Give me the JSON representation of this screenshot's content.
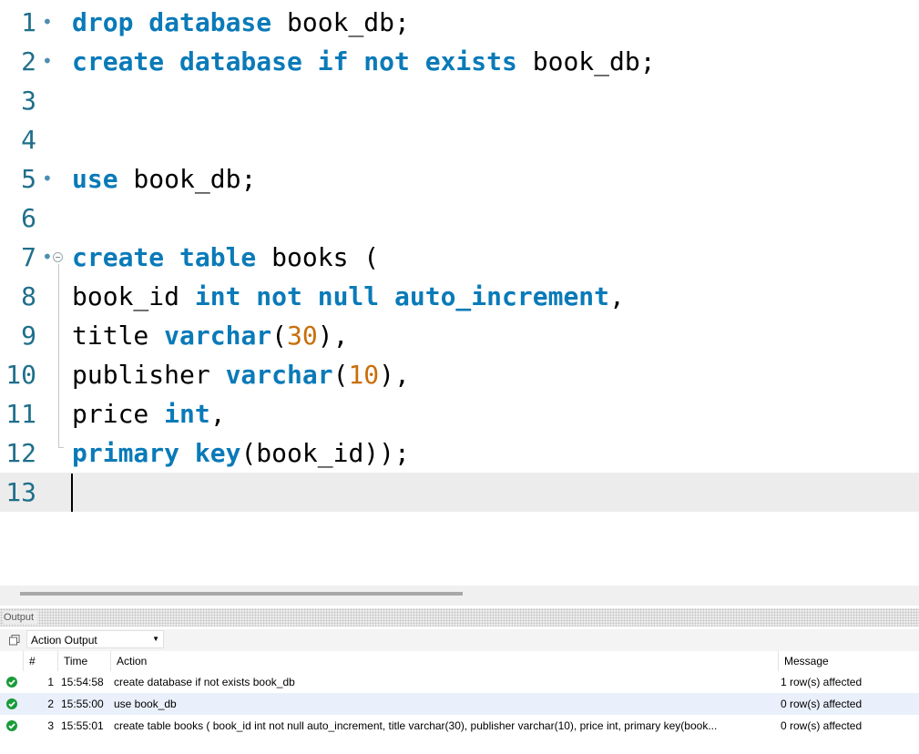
{
  "editor": {
    "lines": [
      {
        "num": "1",
        "marker": "•",
        "tokens": [
          {
            "t": "drop database",
            "c": "kw"
          },
          {
            "t": " book_db;",
            "c": ""
          }
        ]
      },
      {
        "num": "2",
        "marker": "•",
        "tokens": [
          {
            "t": "create database if not exists",
            "c": "kw"
          },
          {
            "t": " book_db;",
            "c": ""
          }
        ]
      },
      {
        "num": "3",
        "marker": "",
        "tokens": []
      },
      {
        "num": "4",
        "marker": "",
        "tokens": []
      },
      {
        "num": "5",
        "marker": "•",
        "tokens": [
          {
            "t": "use",
            "c": "kw"
          },
          {
            "t": " book_db;",
            "c": ""
          }
        ]
      },
      {
        "num": "6",
        "marker": "",
        "tokens": []
      },
      {
        "num": "7",
        "marker": "•",
        "fold": true,
        "tokens": [
          {
            "t": "create table",
            "c": "kw"
          },
          {
            "t": " books (",
            "c": ""
          }
        ]
      },
      {
        "num": "8",
        "marker": "",
        "tokens": [
          {
            "t": "book_id ",
            "c": ""
          },
          {
            "t": "int not null auto_increment",
            "c": "kw"
          },
          {
            "t": ",",
            "c": ""
          }
        ]
      },
      {
        "num": "9",
        "marker": "",
        "tokens": [
          {
            "t": "title ",
            "c": ""
          },
          {
            "t": "varchar",
            "c": "kw"
          },
          {
            "t": "(",
            "c": ""
          },
          {
            "t": "30",
            "c": "num"
          },
          {
            "t": "),",
            "c": ""
          }
        ]
      },
      {
        "num": "10",
        "marker": "",
        "tokens": [
          {
            "t": "publisher ",
            "c": ""
          },
          {
            "t": "varchar",
            "c": "kw"
          },
          {
            "t": "(",
            "c": ""
          },
          {
            "t": "10",
            "c": "num"
          },
          {
            "t": "),",
            "c": ""
          }
        ]
      },
      {
        "num": "11",
        "marker": "",
        "tokens": [
          {
            "t": "price ",
            "c": ""
          },
          {
            "t": "int",
            "c": "kw"
          },
          {
            "t": ",",
            "c": ""
          }
        ]
      },
      {
        "num": "12",
        "marker": "",
        "tokens": [
          {
            "t": "primary key",
            "c": "kw"
          },
          {
            "t": "(book_id));",
            "c": ""
          }
        ]
      },
      {
        "num": "13",
        "marker": "",
        "current": true,
        "tokens": []
      }
    ]
  },
  "output": {
    "panel_label": "Output",
    "dropdown_value": "Action Output",
    "columns": {
      "num": "#",
      "time": "Time",
      "action": "Action",
      "message": "Message"
    },
    "rows": [
      {
        "num": "1",
        "time": "15:54:58",
        "action": "create database if not exists book_db",
        "message": "1 row(s) affected"
      },
      {
        "num": "2",
        "time": "15:55:00",
        "action": "use book_db",
        "message": "0 row(s) affected"
      },
      {
        "num": "3",
        "time": "15:55:01",
        "action": "create table books ( book_id int not null auto_increment, title varchar(30), publisher varchar(10), price int, primary key(book...",
        "message": "0 row(s) affected"
      }
    ]
  },
  "colors": {
    "keyword": "#0a7ab8",
    "number": "#c96e0a",
    "line_number": "#1f6f8b",
    "success": "#1a9b3a",
    "row_highlight": "#e9f0fb"
  }
}
